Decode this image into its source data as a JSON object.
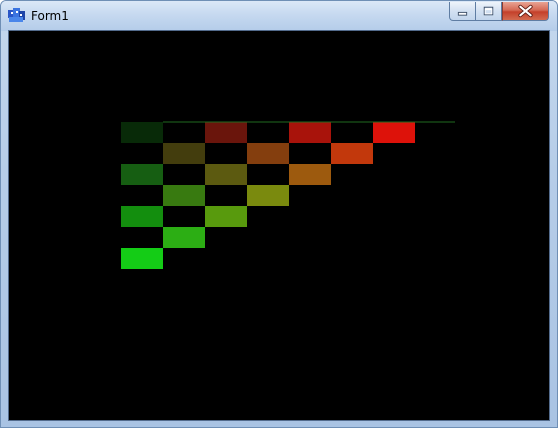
{
  "window": {
    "title": "Form1",
    "icon": "app-form-icon"
  },
  "title_buttons": {
    "minimize": "minimize-icon",
    "maximize": "maximize-icon",
    "close": "close-icon"
  },
  "colors": {
    "client_background": "#000000",
    "line": "#1f6a1f"
  },
  "grid": {
    "cells": [
      {
        "row": 0,
        "col": 0,
        "color": "#082a08"
      },
      {
        "row": 0,
        "col": 2,
        "color": "#6a150c"
      },
      {
        "row": 0,
        "col": 4,
        "color": "#a8130b"
      },
      {
        "row": 0,
        "col": 6,
        "color": "#dd120a"
      },
      {
        "row": 1,
        "col": 1,
        "color": "#433d0d"
      },
      {
        "row": 1,
        "col": 3,
        "color": "#843e0e"
      },
      {
        "row": 1,
        "col": 5,
        "color": "#c2380c"
      },
      {
        "row": 2,
        "col": 0,
        "color": "#165e12"
      },
      {
        "row": 2,
        "col": 2,
        "color": "#5c5a10"
      },
      {
        "row": 2,
        "col": 4,
        "color": "#9d5a0e"
      },
      {
        "row": 3,
        "col": 1,
        "color": "#387a10"
      },
      {
        "row": 3,
        "col": 3,
        "color": "#7a8a0e"
      },
      {
        "row": 4,
        "col": 0,
        "color": "#138e0e"
      },
      {
        "row": 4,
        "col": 2,
        "color": "#589a0d"
      },
      {
        "row": 5,
        "col": 1,
        "color": "#2cae14"
      },
      {
        "row": 6,
        "col": 0,
        "color": "#14cc16"
      }
    ]
  }
}
